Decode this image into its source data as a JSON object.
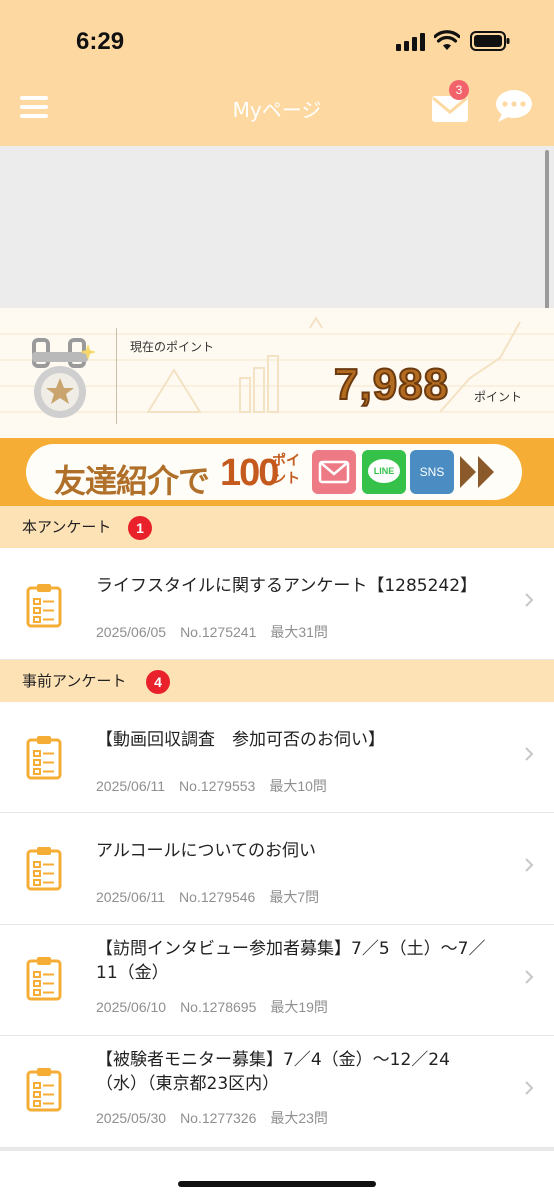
{
  "status_bar": {
    "time": "6:29"
  },
  "header": {
    "title": "Myページ",
    "mail_badge": "3"
  },
  "points": {
    "label": "現在のポイント",
    "value": "7,988",
    "unit": "ポイント"
  },
  "banner": {
    "text": "友達紹介で",
    "amount": "100",
    "unit": "ポイント",
    "line_label": "LINE",
    "sns_label": "SNS"
  },
  "sections": [
    {
      "label": "本アンケート",
      "count": "1",
      "items": [
        {
          "title": "ライフスタイルに関するアンケート【1285242】",
          "meta": "2025/06/05　No.1275241　最大31問"
        }
      ]
    },
    {
      "label": "事前アンケート",
      "count": "4",
      "items": [
        {
          "title": "【動画回収調査　参加可否のお伺い】",
          "meta": "2025/06/11　No.1279553　最大10問"
        },
        {
          "title": "アルコールについてのお伺い",
          "meta": "2025/06/11　No.1279546　最大7問"
        },
        {
          "title": "【訪問インタビュー参加者募集】7／5（土）～7／11（金）",
          "meta": "2025/06/10　No.1278695　最大19問"
        },
        {
          "title": "【被験者モニター募集】7／4（金）～12／24（水）（東京都23区内）",
          "meta": "2025/05/30　No.1277326　最大23問"
        }
      ]
    }
  ],
  "colors": {
    "header_bg": "#fdd9a1",
    "section_bg": "#fde2b6",
    "accent_orange": "#f5ad35",
    "badge_red": "#e8212b"
  }
}
